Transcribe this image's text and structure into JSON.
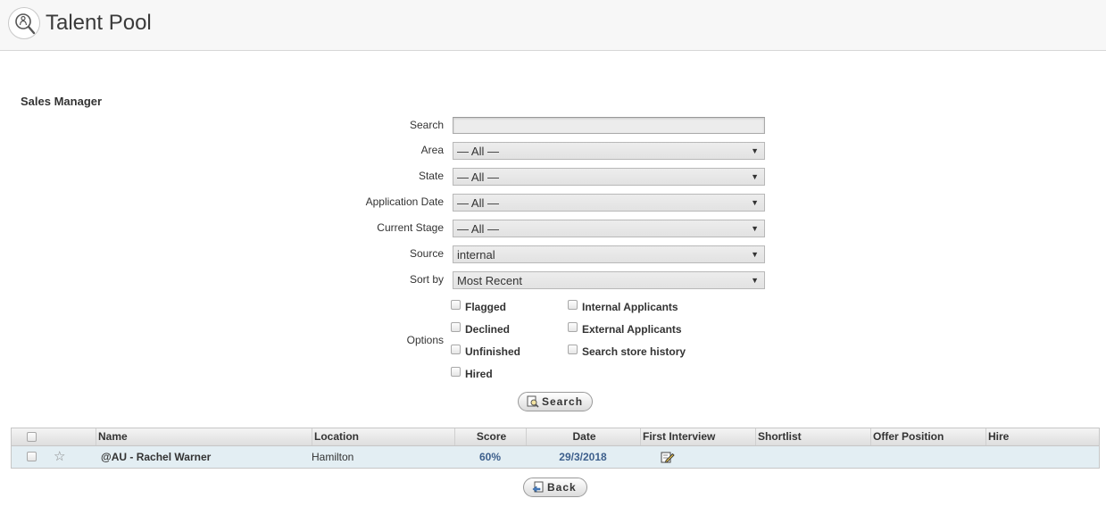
{
  "header": {
    "title": "Talent Pool",
    "logo_icon": "magnifier-person-icon"
  },
  "section": {
    "title": "Sales Manager"
  },
  "filters": {
    "search": {
      "label": "Search",
      "value": ""
    },
    "area": {
      "label": "Area",
      "value": "— All —"
    },
    "state": {
      "label": "State",
      "value": "— All —"
    },
    "application_date": {
      "label": "Application Date",
      "value": "— All —"
    },
    "current_stage": {
      "label": "Current Stage",
      "value": "— All —"
    },
    "source": {
      "label": "Source",
      "value": "internal"
    },
    "sort_by": {
      "label": "Sort by",
      "value": "Most Recent"
    }
  },
  "options": {
    "label": "Options",
    "flagged": "Flagged",
    "declined": "Declined",
    "unfinished": "Unfinished",
    "hired": "Hired",
    "internal_applicants": "Internal Applicants",
    "external_applicants": "External Applicants",
    "search_store_history": "Search store history"
  },
  "buttons": {
    "search": "Search",
    "back": "Back"
  },
  "table": {
    "columns": {
      "name": "Name",
      "location": "Location",
      "score": "Score",
      "date": "Date",
      "first_interview": "First Interview",
      "shortlist": "Shortlist",
      "offer_position": "Offer Position",
      "hire": "Hire"
    },
    "rows": [
      {
        "name": "@AU - Rachel Warner",
        "location": "Hamilton",
        "score": "60%",
        "date": "29/3/2018",
        "starred": false
      }
    ]
  },
  "colors": {
    "row_bg": "#e3eef3",
    "link": "#3d5f8c",
    "header_bg": "#f7f7f7"
  }
}
